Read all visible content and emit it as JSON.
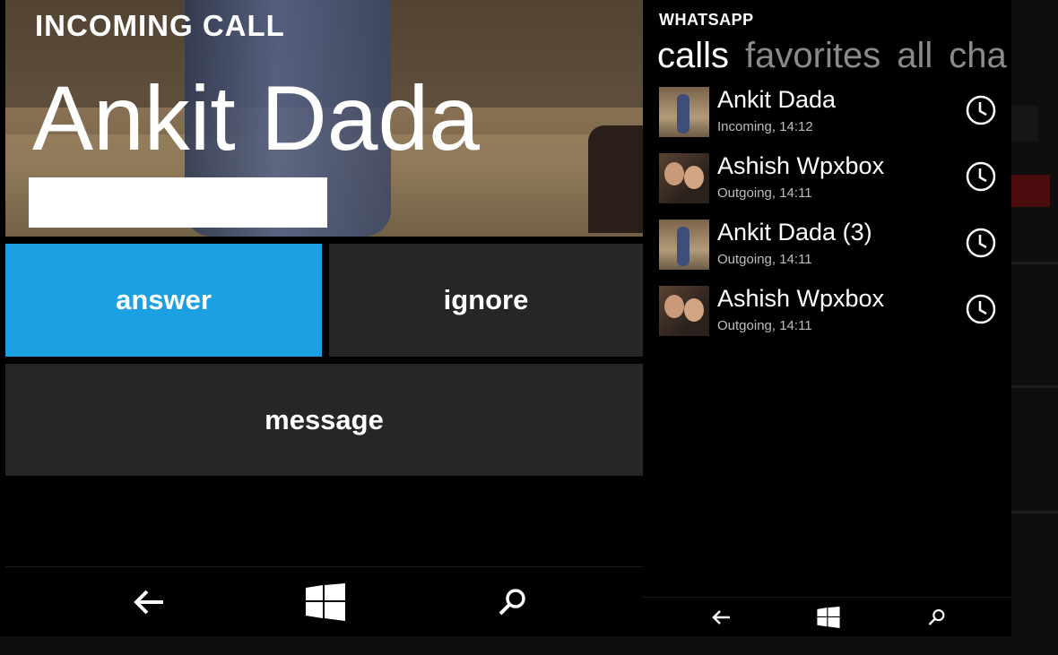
{
  "call_screen": {
    "incoming_label": "INCOMING CALL",
    "caller_name": "Ankit Dada",
    "actions": {
      "answer": "answer",
      "ignore": "ignore",
      "message": "message"
    },
    "accent_color": "#1ba1e2",
    "tile_color": "#262626"
  },
  "whatsapp": {
    "app_title": "WHATSAPP",
    "pivot_tabs": [
      {
        "label": "calls",
        "active": true
      },
      {
        "label": "favorites",
        "active": false
      },
      {
        "label": "all",
        "active": false
      },
      {
        "label": "cha",
        "active": false
      }
    ],
    "calls": [
      {
        "name": "Ankit Dada",
        "detail": "Incoming, 14:12",
        "icon": "clock-icon"
      },
      {
        "name": "Ashish Wpxbox",
        "detail": "Outgoing, 14:11",
        "icon": "clock-icon"
      },
      {
        "name": "Ankit Dada (3)",
        "detail": "Outgoing, 14:11",
        "icon": "clock-icon"
      },
      {
        "name": "Ashish Wpxbox",
        "detail": "Outgoing, 14:11",
        "icon": "clock-icon"
      }
    ]
  },
  "navbar_icons": [
    "back-arrow-icon",
    "windows-logo-icon",
    "search-icon"
  ]
}
